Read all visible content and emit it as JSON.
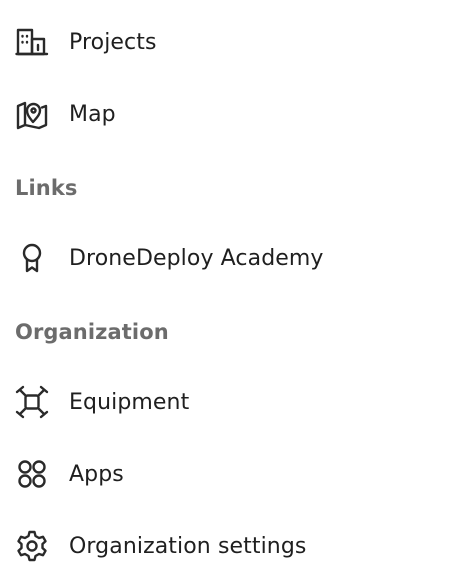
{
  "nav": {
    "projects": {
      "label": "Projects",
      "icon": "building-icon"
    },
    "map": {
      "label": "Map",
      "icon": "map-pin-icon"
    }
  },
  "links": {
    "heading": "Links",
    "academy": {
      "label": "DroneDeploy Academy",
      "icon": "ribbon-award-icon"
    }
  },
  "organization": {
    "heading": "Organization",
    "equipment": {
      "label": "Equipment",
      "icon": "drone-icon"
    },
    "apps": {
      "label": "Apps",
      "icon": "apps-grid-icon"
    },
    "settings": {
      "label": "Organization settings",
      "icon": "gear-icon"
    }
  },
  "colors": {
    "text": "#1f1f1f",
    "section_heading": "#6c6c6c",
    "icon": "#2a2a2a"
  }
}
